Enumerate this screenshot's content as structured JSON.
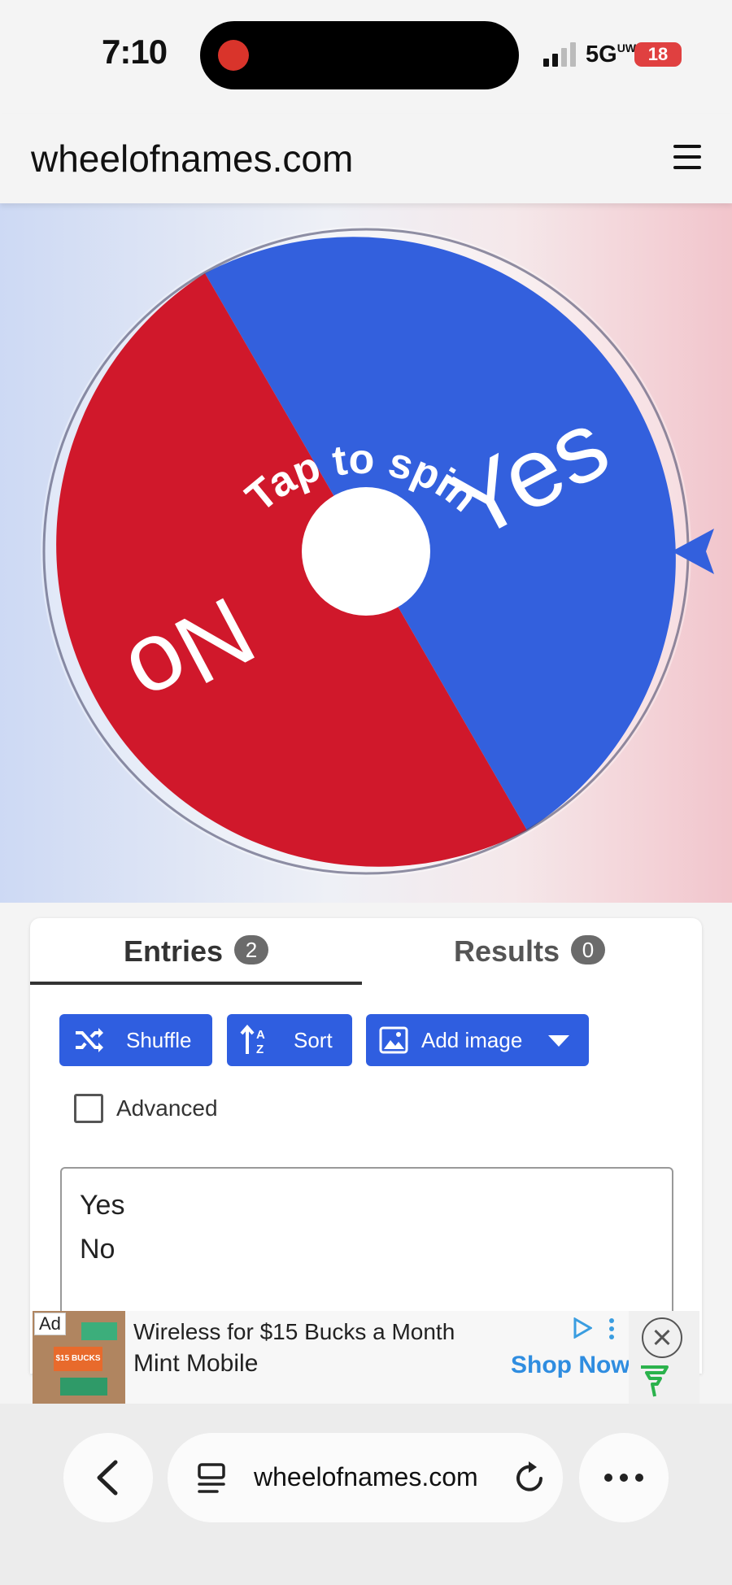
{
  "status_bar": {
    "time": "7:10",
    "network": "5G",
    "network_suffix": "UW",
    "battery": "18"
  },
  "header": {
    "site_title": "wheelofnames.com"
  },
  "wheel": {
    "prompt": "Tap to spin",
    "segments": [
      {
        "label": "Yes",
        "color": "#3360dd"
      },
      {
        "label": "No",
        "color": "#d0182b"
      }
    ],
    "pointer_color": "#3360dd"
  },
  "tabs": {
    "entries": {
      "label": "Entries",
      "count": "2"
    },
    "results": {
      "label": "Results",
      "count": "0"
    }
  },
  "toolbar": {
    "shuffle_label": "Shuffle",
    "sort_label": "Sort",
    "add_image_label": "Add image"
  },
  "advanced": {
    "label": "Advanced",
    "checked": false
  },
  "entries_text": [
    "Yes",
    "No"
  ],
  "ad": {
    "tag": "Ad",
    "image_text": "$15 BUCKS",
    "headline": "Wireless for $15 Bucks a Month",
    "advertiser": "Mint Mobile",
    "cta": "Shop Now"
  },
  "browser": {
    "url": "wheelofnames.com"
  },
  "colors": {
    "accent": "#2f5ee0",
    "link": "#2f8de0"
  }
}
